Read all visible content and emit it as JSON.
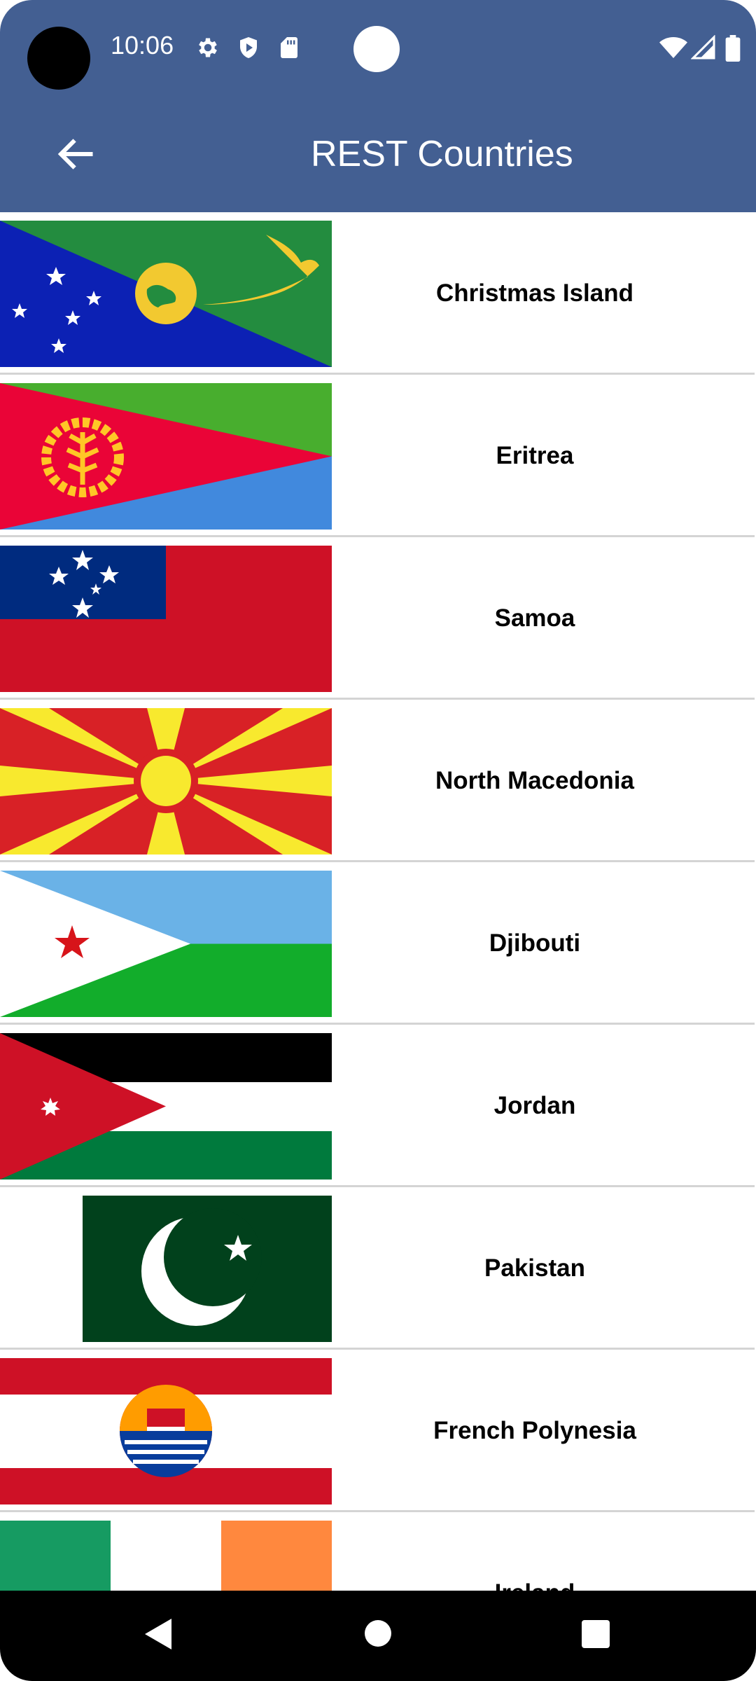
{
  "status_bar": {
    "time": "10:06"
  },
  "app_bar": {
    "title": "REST Countries"
  },
  "countries": [
    {
      "name": "Christmas Island"
    },
    {
      "name": "Eritrea"
    },
    {
      "name": "Samoa"
    },
    {
      "name": "North Macedonia"
    },
    {
      "name": "Djibouti"
    },
    {
      "name": "Jordan"
    },
    {
      "name": "Pakistan"
    },
    {
      "name": "French Polynesia"
    },
    {
      "name": "Ireland"
    }
  ],
  "colors": {
    "app_bar": "#435f92",
    "divider": "#d4d4d4"
  },
  "icons": {
    "status": [
      "settings-icon",
      "shield-icon",
      "sd-card-icon",
      "wifi-icon",
      "signal-icon",
      "battery-icon"
    ],
    "navigation": [
      "back-arrow-icon",
      "nav-back-icon",
      "nav-home-icon",
      "nav-recents-icon"
    ]
  }
}
